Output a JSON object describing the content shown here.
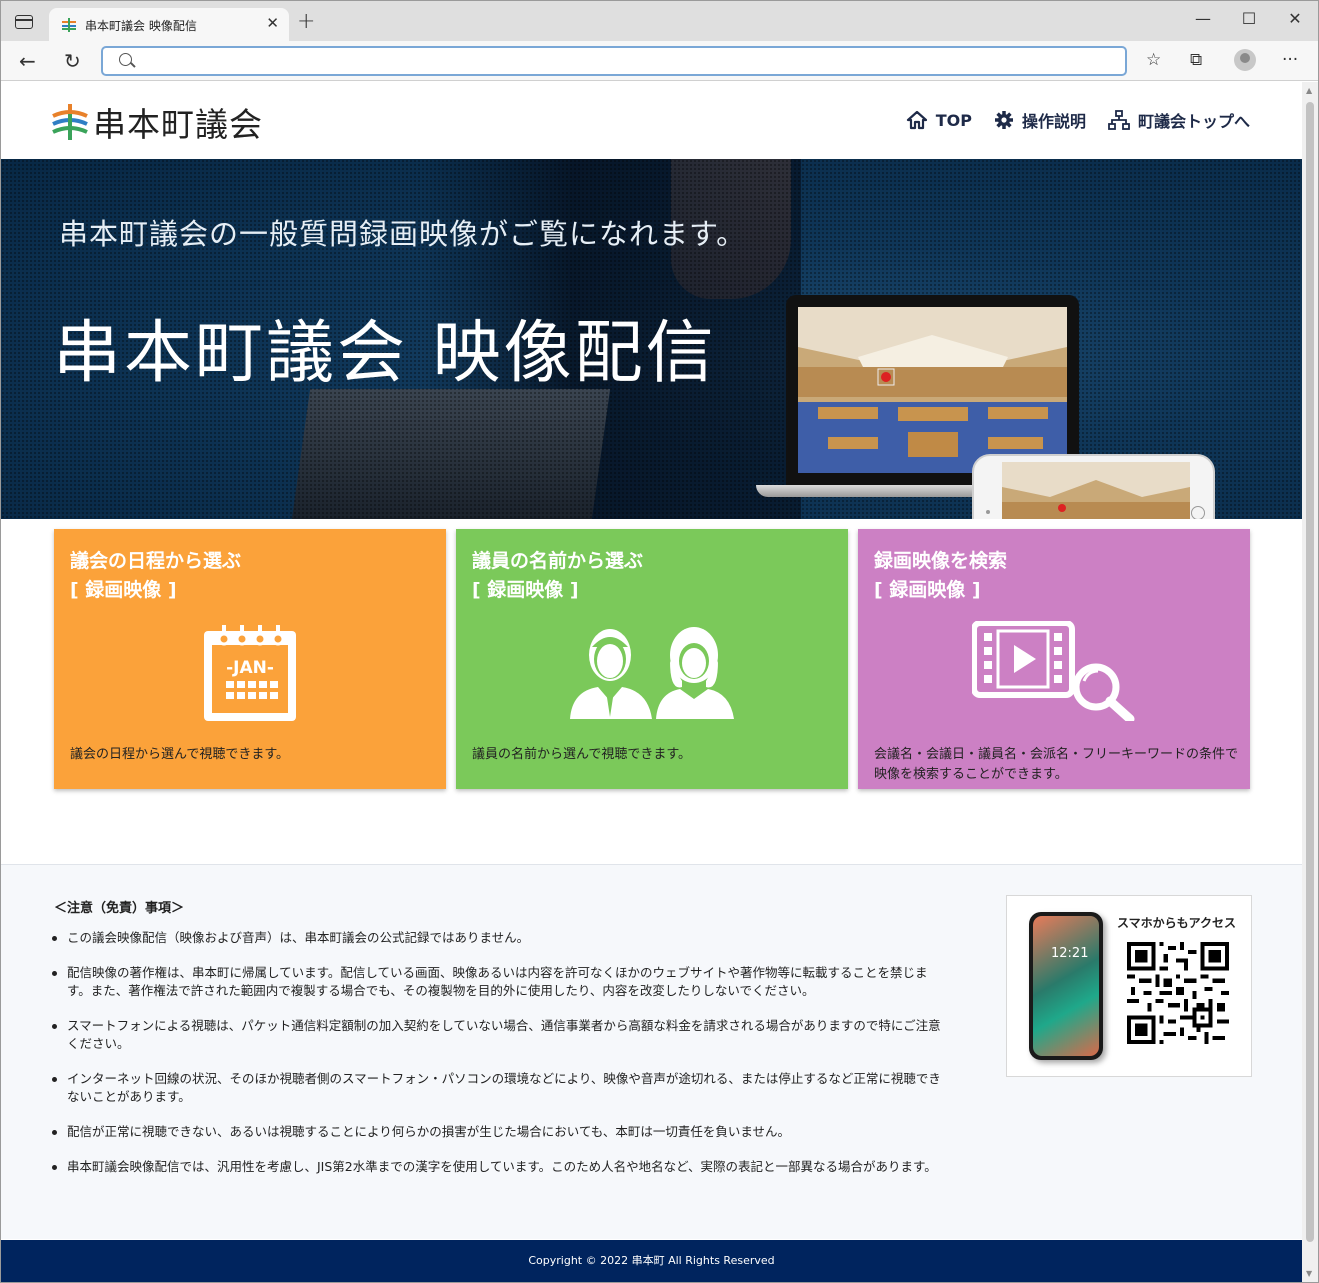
{
  "browser": {
    "tab_title": "串本町議会 映像配信",
    "tab_close": "✕",
    "new_tab": "+",
    "minimize": "—",
    "maximize": "☐",
    "close": "✕",
    "back": "←",
    "reload": "↻",
    "address_value": "",
    "favorites_icon": "☆",
    "collections_icon": "⧉",
    "more_icon": "···"
  },
  "header": {
    "logo_text": "串本町議会",
    "nav": [
      {
        "label": "TOP",
        "icon": "home-icon"
      },
      {
        "label": "操作説明",
        "icon": "gear-icon"
      },
      {
        "label": "町議会トップへ",
        "icon": "sitemap-icon"
      }
    ]
  },
  "hero": {
    "subtitle": "串本町議会の一般質問録画映像がご覧になれます。",
    "title": "串本町議会 映像配信"
  },
  "cards": [
    {
      "title_line1": "議会の日程から選ぶ",
      "title_line2": "[ 録画映像 ]",
      "icon": "calendar-icon",
      "icon_text": "-JAN-",
      "desc": "議会の日程から選んで視聴できます。",
      "color": "#fba23a"
    },
    {
      "title_line1": "議員の名前から選ぶ",
      "title_line2": "[ 録画映像 ]",
      "icon": "people-icon",
      "desc": "議員の名前から選んで視聴できます。",
      "color": "#7bc95a"
    },
    {
      "title_line1": "録画映像を検索",
      "title_line2": "[ 録画映像 ]",
      "icon": "video-search-icon",
      "desc": "会議名・会議日・議員名・会派名・フリーキーワードの条件で映像を検索することができます。",
      "color": "#cc80c4"
    }
  ],
  "notice": {
    "heading": "＜注意（免責）事項＞",
    "items": [
      "この議会映像配信（映像および音声）は、串本町議会の公式記録ではありません。",
      "配信映像の著作権は、串本町に帰属しています。配信している画面、映像あるいは内容を許可なくほかのウェブサイトや著作物等に転載することを禁じます。また、著作権法で許された範囲内で複製する場合でも、その複製物を目的外に使用したり、内容を改変したりしないでください。",
      "スマートフォンによる視聴は、パケット通信料定額制の加入契約をしていない場合、通信事業者から高額な料金を請求される場合がありますので特にご注意ください。",
      "インターネット回線の状況、そのほか視聴者側のスマートフォン・パソコンの環境などにより、映像や音声が途切れる、または停止するなど正常に視聴できないことがあります。",
      "配信が正常に視聴できない、あるいは視聴することにより何らかの損害が生じた場合においても、本町は一切責任を負いません。",
      "串本町議会映像配信では、汎用性を考慮し、JIS第2水準までの漢字を使用しています。このため人名や地名など、実際の表記と一部異なる場合があります。"
    ],
    "qr_label": "スマホからもアクセス",
    "phone_time": "12:21"
  },
  "footer": {
    "copyright": "Copyright © 2022 串本町 All Rights Reserved"
  },
  "colors": {
    "nav_text": "#1e2a48",
    "footer_bg": "#00245e"
  }
}
